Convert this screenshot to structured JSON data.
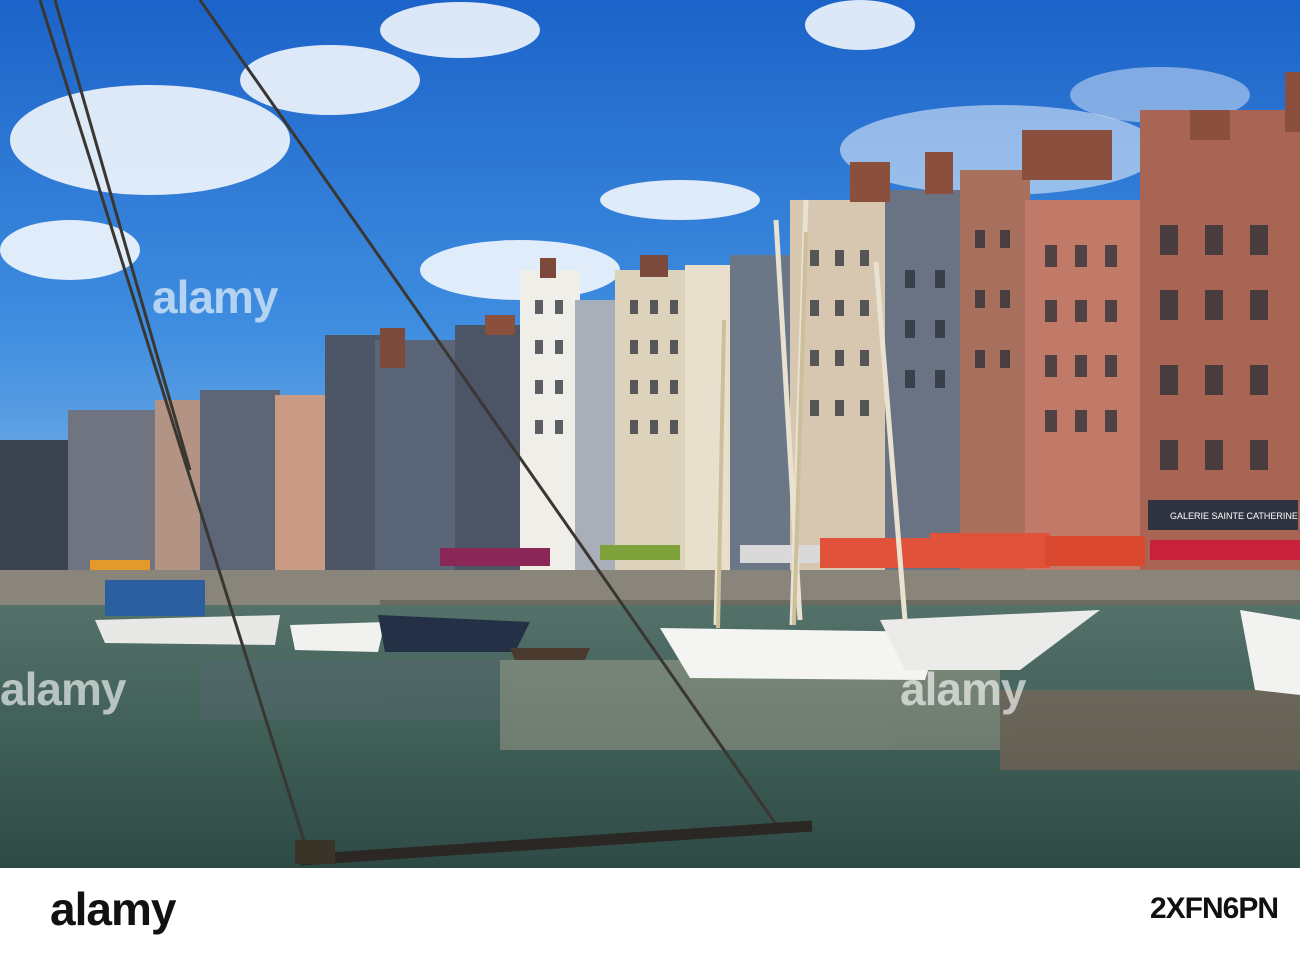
{
  "photo": {
    "watermark_text": "alamy",
    "storefront_sign": "GALERIE SAINTE CATHERINE",
    "colors": {
      "sky_top": "#1f6fd1",
      "sky_bottom": "#7fb4ea",
      "water": "#3d5f55",
      "awning_red": "#e0533a",
      "slate": "#5e6a7c"
    }
  },
  "footer": {
    "logo": "alamy",
    "image_id": "2XFN6PN"
  }
}
